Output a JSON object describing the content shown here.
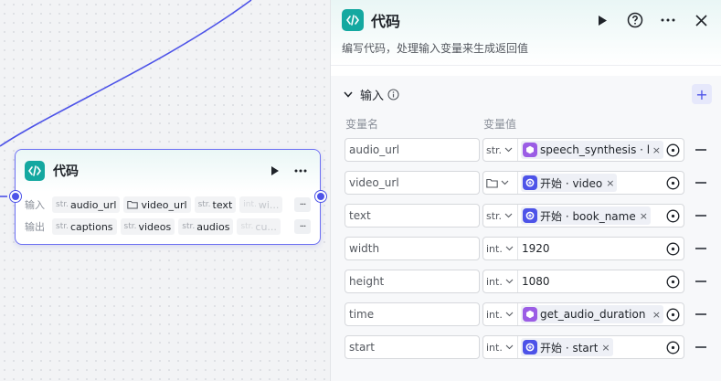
{
  "node": {
    "title": "代码",
    "input_label": "输入",
    "output_label": "输出",
    "inputs": [
      {
        "type": "str.",
        "name": "audio_url",
        "fade": false
      },
      {
        "type": "folder",
        "name": "video_url",
        "fade": false
      },
      {
        "type": "str.",
        "name": "text",
        "fade": false
      },
      {
        "type": "int.",
        "name": "wi...",
        "fade": true
      }
    ],
    "outputs": [
      {
        "type": "str.",
        "name": "captions",
        "fade": false
      },
      {
        "type": "str.",
        "name": "videos",
        "fade": false
      },
      {
        "type": "str.",
        "name": "audios",
        "fade": false
      },
      {
        "type": "str.",
        "name": "cu...",
        "fade": true
      }
    ],
    "more": "···"
  },
  "panel": {
    "title": "代码",
    "description": "编写代码，处理输入变量来生成返回值",
    "section_title": "输入",
    "add": "+",
    "col_name": "变量名",
    "col_value": "变量值",
    "rows": [
      {
        "name": "audio_url",
        "type": "str.",
        "kind": "ref",
        "icon": "purple",
        "value": "speech_synthesis · l···"
      },
      {
        "name": "video_url",
        "type": "folder",
        "kind": "ref",
        "icon": "blue",
        "value": "开始 · video"
      },
      {
        "name": "text",
        "type": "str.",
        "kind": "ref",
        "icon": "blue",
        "value": "开始 · book_name"
      },
      {
        "name": "width",
        "type": "int.",
        "kind": "literal",
        "value": "1920"
      },
      {
        "name": "height",
        "type": "int.",
        "kind": "literal",
        "value": "1080"
      },
      {
        "name": "time",
        "type": "int.",
        "kind": "ref",
        "icon": "purple",
        "value": "get_audio_duration · d"
      },
      {
        "name": "start",
        "type": "int.",
        "kind": "ref",
        "icon": "blue",
        "value": "开始 · start"
      }
    ]
  },
  "colors": {
    "accent": "#4d53e8",
    "node_icon": "#14a8a0",
    "plugin": "#9b5de5"
  }
}
